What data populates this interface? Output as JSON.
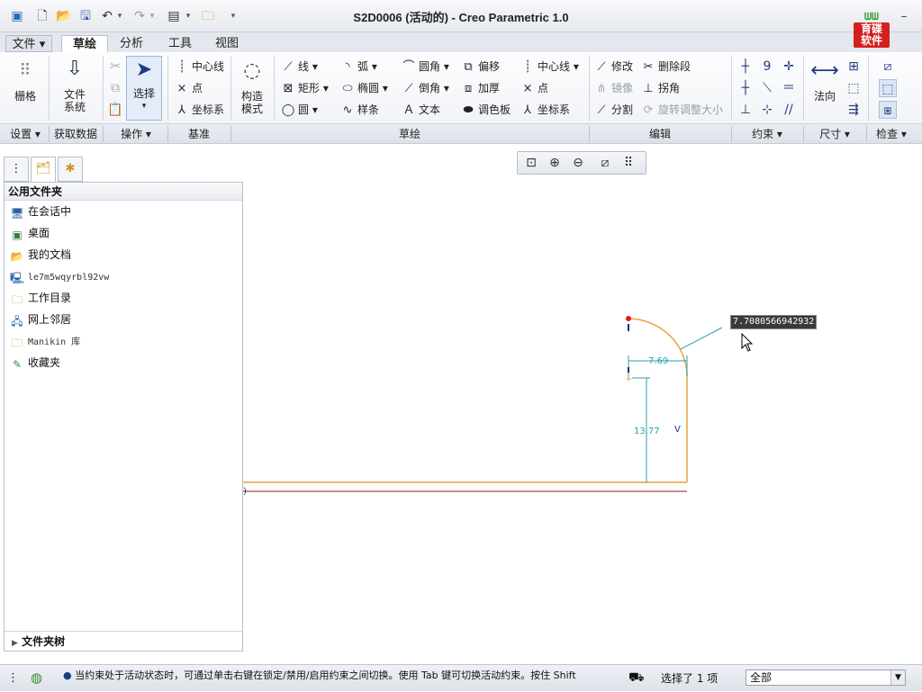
{
  "window": {
    "title": "S2D0006 (活动的) - Creo Parametric 1.0",
    "quick_access": [
      "creo-app-icon",
      "new-icon",
      "open-icon",
      "save-icon",
      "undo-icon",
      "redo-icon",
      "window-icon",
      "folder-icon",
      "customize-icon"
    ]
  },
  "tabs": {
    "file": "文件",
    "items": [
      "草绘",
      "分析",
      "工具",
      "视图"
    ],
    "active": "草绘"
  },
  "ribbon": {
    "setup": {
      "grid": "栅格"
    },
    "get_data": {
      "file_system": [
        "文件",
        "系统"
      ]
    },
    "operations": {
      "select": "选择"
    },
    "datum": {
      "centerline": "中心线",
      "point": "点",
      "csys": "坐标系"
    },
    "construction": {
      "label": [
        "构造",
        "模式"
      ]
    },
    "sketch": {
      "line": "线",
      "rect": "矩形",
      "circle": "圆",
      "arc": "弧",
      "ellipse": "椭圆",
      "spline": "样条",
      "fillet": "圆角",
      "chamfer": "倒角",
      "text": "文本",
      "offset": "偏移",
      "thicken": "加厚",
      "palette": "调色板",
      "centerline": "中心线",
      "point": "点",
      "csys": "坐标系"
    },
    "editing": {
      "modify": "修改",
      "delete_segment": "删除段",
      "mirror": "镜像",
      "corner": "拐角",
      "divide": "分割",
      "rotate_resize": "旋转调整大小"
    },
    "dimension": {
      "normal": "法向"
    },
    "groups": {
      "setup": "设置",
      "get_data": "获取数据",
      "operations": "操作",
      "datum": "基准",
      "sketch": "草绘",
      "editing": "编辑",
      "constraints": "约束",
      "dimension": "尺寸",
      "inspect": "检查"
    }
  },
  "panel": {
    "header": "公用文件夹",
    "items": [
      "在会话中",
      "桌面",
      "我的文档",
      "le7m5wqyrbl92vw",
      "工作目录",
      "网上邻居",
      "Manikin 库",
      "收藏夹"
    ],
    "tree_label": "文件夹树"
  },
  "sketch": {
    "dim_horizontal": "7.69",
    "dim_vertical": "13.77",
    "constraint_v": "V",
    "input_value": "7.7080566942932",
    "colors": {
      "geometry": "#e8a23c",
      "dimension": "#2aa0b0",
      "selected_point": "#e02020",
      "axis": "#8b1a1a"
    }
  },
  "status": {
    "message": "当约束处于活动状态时，可通过单击右键在锁定/禁用/启用约束之间切换。使用 Tab 键可切换活动约束。按住 Shift",
    "selection": "选择了 1 项",
    "filter": "全部"
  },
  "brand": {
    "text": [
      "育碟",
      "软件"
    ]
  }
}
